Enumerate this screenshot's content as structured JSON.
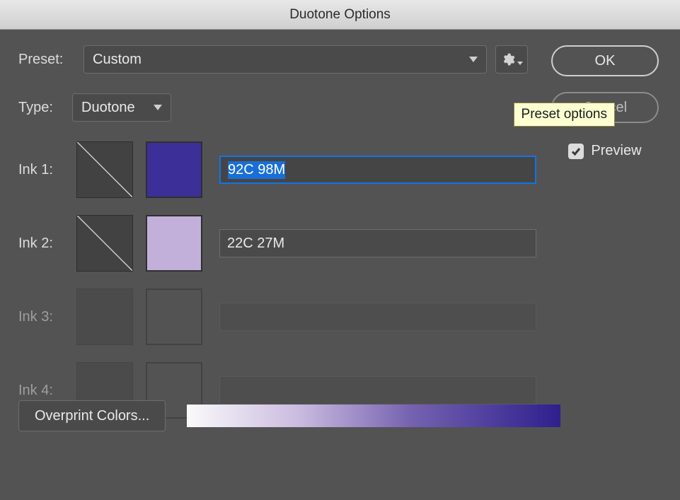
{
  "title": "Duotone Options",
  "preset": {
    "label": "Preset:",
    "value": "Custom"
  },
  "gear_tooltip": "Preset options",
  "type": {
    "label": "Type:",
    "value": "Duotone"
  },
  "inks": [
    {
      "label": "Ink 1:",
      "name": "92C 98M",
      "color": "#3c2f98",
      "active": true,
      "focused": true
    },
    {
      "label": "Ink 2:",
      "name": "22C 27M",
      "color": "#c2b0da",
      "active": true,
      "focused": false
    },
    {
      "label": "Ink 3:",
      "name": "",
      "color": "",
      "active": false,
      "focused": false
    },
    {
      "label": "Ink 4:",
      "name": "",
      "color": "",
      "active": false,
      "focused": false
    }
  ],
  "buttons": {
    "ok": "OK",
    "cancel": "Cancel"
  },
  "preview": {
    "label": "Preview",
    "checked": true
  },
  "overprint": "Overprint Colors...",
  "gradient": {
    "from": "#fafafa",
    "to": "#2e1f8e"
  }
}
